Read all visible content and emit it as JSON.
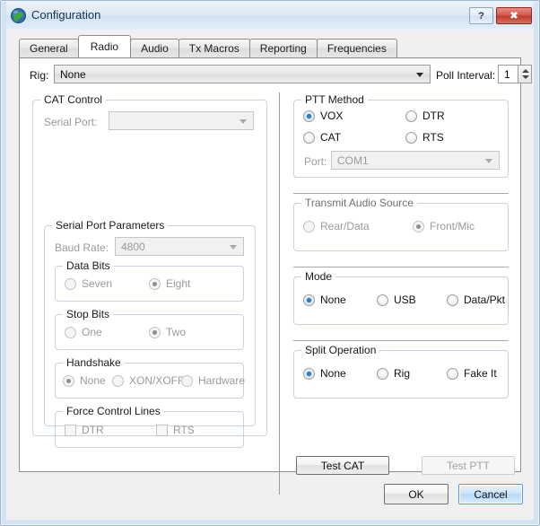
{
  "window": {
    "title": "Configuration",
    "icon": "globe-icon",
    "help_button": "?",
    "close_button": "✖"
  },
  "tabs": [
    {
      "label": "General",
      "active": false
    },
    {
      "label": "Radio",
      "active": true
    },
    {
      "label": "Audio",
      "active": false
    },
    {
      "label": "Tx Macros",
      "active": false
    },
    {
      "label": "Reporting",
      "active": false
    },
    {
      "label": "Frequencies",
      "active": false
    }
  ],
  "rig_row": {
    "label": "Rig:",
    "value": "None",
    "poll_label": "Poll Interval:",
    "poll_value": "1"
  },
  "cat_control": {
    "title": "CAT Control",
    "serial_port_label": "Serial Port:",
    "serial_port_value": ""
  },
  "serial_port_parameters": {
    "title": "Serial Port Parameters",
    "baud_rate_label": "Baud Rate:",
    "baud_rate_value": "4800",
    "data_bits": {
      "title": "Data Bits",
      "options": [
        {
          "label": "Seven",
          "selected": false
        },
        {
          "label": "Eight",
          "selected": true
        }
      ]
    },
    "stop_bits": {
      "title": "Stop Bits",
      "options": [
        {
          "label": "One",
          "selected": false
        },
        {
          "label": "Two",
          "selected": true
        }
      ]
    },
    "handshake": {
      "title": "Handshake",
      "options": [
        {
          "label": "None",
          "selected": true
        },
        {
          "label": "XON/XOFF",
          "selected": false
        },
        {
          "label": "Hardware",
          "selected": false
        }
      ]
    },
    "force_control_lines": {
      "title": "Force Control Lines",
      "options": [
        {
          "label": "DTR",
          "checked": false
        },
        {
          "label": "RTS",
          "checked": false
        }
      ]
    }
  },
  "ptt_method": {
    "title": "PTT Method",
    "options": [
      {
        "label": "VOX",
        "selected": true
      },
      {
        "label": "DTR",
        "selected": false
      },
      {
        "label": "CAT",
        "selected": false
      },
      {
        "label": "RTS",
        "selected": false
      }
    ],
    "port_label": "Port:",
    "port_value": "COM1"
  },
  "transmit_audio_source": {
    "title": "Transmit Audio Source",
    "options": [
      {
        "label": "Rear/Data",
        "selected": false
      },
      {
        "label": "Front/Mic",
        "selected": true
      }
    ]
  },
  "mode": {
    "title": "Mode",
    "options": [
      {
        "label": "None",
        "selected": true
      },
      {
        "label": "USB",
        "selected": false
      },
      {
        "label": "Data/Pkt",
        "selected": false
      }
    ]
  },
  "split_operation": {
    "title": "Split Operation",
    "options": [
      {
        "label": "None",
        "selected": true
      },
      {
        "label": "Rig",
        "selected": false
      },
      {
        "label": "Fake It",
        "selected": false
      }
    ]
  },
  "test_buttons": {
    "test_cat": "Test CAT",
    "test_ptt": "Test PTT"
  },
  "dialog_buttons": {
    "ok": "OK",
    "cancel": "Cancel"
  },
  "colors": {
    "accent": "#1f7fd0",
    "title_bar": "#d2e2f2",
    "close_button": "#bf3a2c",
    "frame": "#d4e3f2"
  }
}
